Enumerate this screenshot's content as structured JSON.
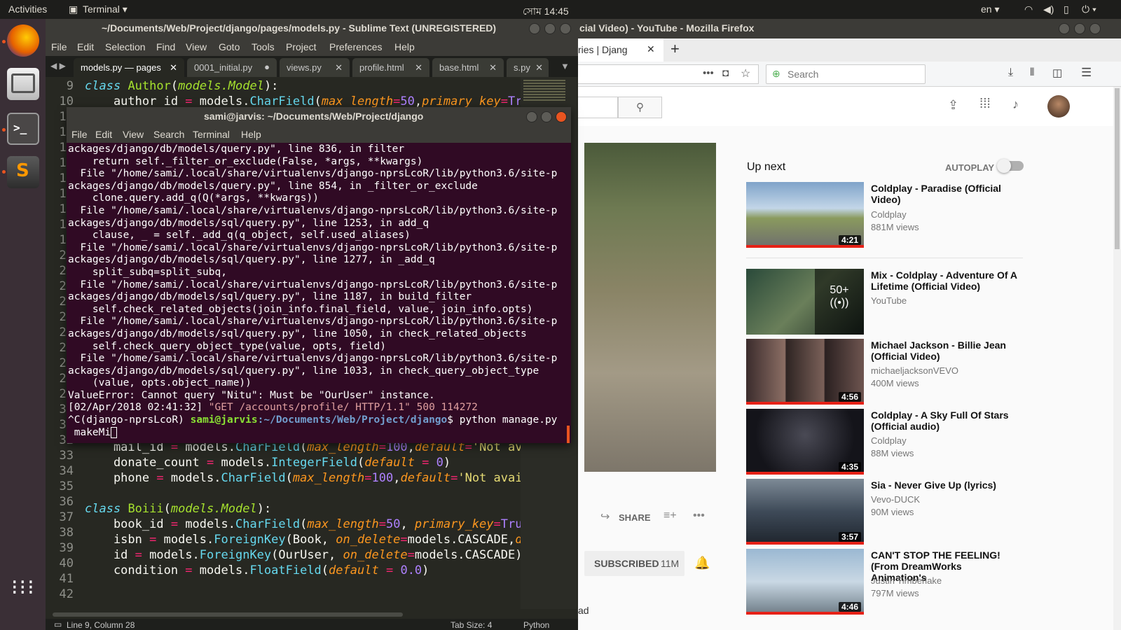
{
  "top_panel": {
    "activities": "Activities",
    "app_menu": "Terminal ▾",
    "clock": "সোম 14:45",
    "lang": "en ▾"
  },
  "firefox": {
    "title": "cial Video) - YouTube - Mozilla Firefox",
    "tab_label": "ries | Djang",
    "tab_close": "✕",
    "new_tab": "+",
    "search_placeholder": "Search",
    "youtube": {
      "upnext": "Up next",
      "autoplay": "AUTOPLAY",
      "share": "SHARE",
      "subscribed": "SUBSCRIBED",
      "sub_count": "11M",
      "partial_text": "ad",
      "videos": [
        {
          "title": "Coldplay - Paradise (Official Video)",
          "channel": "Coldplay",
          "views": "881M views",
          "duration": "4:21"
        },
        {
          "title": "Mix - Coldplay - Adventure Of A Lifetime (Official Video)",
          "channel": "YouTube",
          "views": "",
          "duration": "",
          "badge": "50+"
        },
        {
          "title": "Michael Jackson - Billie Jean (Official Video)",
          "channel": "michaeljacksonVEVO",
          "views": "400M views",
          "duration": "4:56"
        },
        {
          "title": "Coldplay - A Sky Full Of Stars (Official audio)",
          "channel": "Coldplay",
          "views": "88M views",
          "duration": "4:35"
        },
        {
          "title": "Sia - Never Give Up (lyrics)",
          "channel": "Vevo-DUCK",
          "views": "90M views",
          "duration": "3:57"
        },
        {
          "title": "CAN'T STOP THE FEELING! (From DreamWorks Animation's",
          "channel": "Justin Timberlake",
          "views": "797M views",
          "duration": "4:46"
        }
      ]
    }
  },
  "sublime": {
    "title": "~/Documents/Web/Project/django/pages/models.py - Sublime Text (UNREGISTERED)",
    "menu": [
      "File",
      "Edit",
      "Selection",
      "Find",
      "View",
      "Goto",
      "Tools",
      "Project",
      "Preferences",
      "Help"
    ],
    "tabs": [
      "models.py — pages",
      "0001_initial.py",
      "views.py",
      "profile.html",
      "base.html",
      "s.py"
    ],
    "line_numbers": [
      "9",
      "10",
      "11",
      "12",
      "13",
      "14",
      "15",
      "16",
      "17",
      "18",
      "19",
      "20",
      "21",
      "22",
      "23",
      "24",
      "25",
      "26",
      "27",
      "28",
      "29",
      "30",
      "31",
      "32",
      "33",
      "34",
      "35",
      "36",
      "37",
      "38",
      "39",
      "40",
      "41",
      "42"
    ],
    "status_left": "Line 9, Column 28",
    "status_tab": "Tab Size: 4",
    "status_lang": "Python"
  },
  "terminal": {
    "title": "sami@jarvis: ~/Documents/Web/Project/django",
    "menu": [
      "File",
      "Edit",
      "View",
      "Search",
      "Terminal",
      "Help"
    ],
    "lines": [
      "ackages/django/db/models/query.py\", line 836, in filter",
      "    return self._filter_or_exclude(False, *args, **kwargs)",
      "  File \"/home/sami/.local/share/virtualenvs/django-nprsLcoR/lib/python3.6/site-p",
      "ackages/django/db/models/query.py\", line 854, in _filter_or_exclude",
      "    clone.query.add_q(Q(*args, **kwargs))",
      "  File \"/home/sami/.local/share/virtualenvs/django-nprsLcoR/lib/python3.6/site-p",
      "ackages/django/db/models/sql/query.py\", line 1253, in add_q",
      "    clause, _ = self._add_q(q_object, self.used_aliases)",
      "  File \"/home/sami/.local/share/virtualenvs/django-nprsLcoR/lib/python3.6/site-p",
      "ackages/django/db/models/sql/query.py\", line 1277, in _add_q",
      "    split_subq=split_subq,",
      "  File \"/home/sami/.local/share/virtualenvs/django-nprsLcoR/lib/python3.6/site-p",
      "ackages/django/db/models/sql/query.py\", line 1187, in build_filter",
      "    self.check_related_objects(join_info.final_field, value, join_info.opts)",
      "  File \"/home/sami/.local/share/virtualenvs/django-nprsLcoR/lib/python3.6/site-p",
      "ackages/django/db/models/sql/query.py\", line 1050, in check_related_objects",
      "    self.check_query_object_type(value, opts, field)",
      "  File \"/home/sami/.local/share/virtualenvs/django-nprsLcoR/lib/python3.6/site-p",
      "ackages/django/db/models/sql/query.py\", line 1033, in check_query_object_type",
      "    (value, opts.object_name))",
      "ValueError: Cannot query \"Nitu\": Must be \"OurUser\" instance."
    ],
    "log_line": "[02/Apr/2018 02:41:32] ",
    "log_request": "\"GET /accounts/profile/ HTTP/1.1\" 500 114272",
    "prompt_env": "^C(django-nprsLcoR) ",
    "prompt_user": "sami@jarvis",
    "prompt_path": ":~/Documents/Web/Project/django",
    "prompt_cmd": "$ python manage.py",
    "prompt_cont": " makeMi"
  }
}
